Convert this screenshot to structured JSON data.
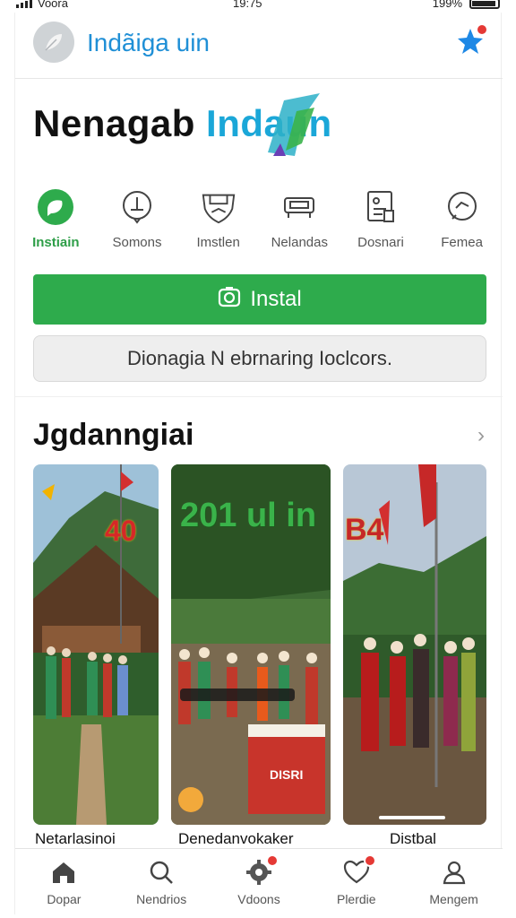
{
  "status_bar": {
    "carrier": "Voora",
    "time": "19:75",
    "battery": "199%"
  },
  "header": {
    "title": "Indãiga uin",
    "logo_icon": "leaf-icon",
    "notification_icon": "star-icon",
    "notification_dot_color": "#e53935"
  },
  "hero": {
    "title_part1": "Nenagab",
    "title_part2": "Indaun"
  },
  "quick_actions": [
    {
      "label": "Instiain",
      "icon": "chat-bubble-icon",
      "active": true
    },
    {
      "label": "Somons",
      "icon": "pin-icon",
      "active": false
    },
    {
      "label": "Imstlen",
      "icon": "shield-icon",
      "active": false
    },
    {
      "label": "Nelandas",
      "icon": "sofa-icon",
      "active": false
    },
    {
      "label": "Dosnari",
      "icon": "document-icon",
      "active": false
    },
    {
      "label": "Femea",
      "icon": "message-icon",
      "active": false
    }
  ],
  "install_button": {
    "label": "Instal",
    "icon": "camera-icon",
    "color": "#2eab4c"
  },
  "secondary_button": {
    "label": "Dionagia N ebrnaring Ioclcors."
  },
  "section": {
    "title": "Jgdanngiai"
  },
  "cards": [
    {
      "caption": "Netarlasinoi",
      "overlay_text": "40"
    },
    {
      "caption": "Denedanvokaker",
      "overlay_text": "201 ul in",
      "banner_text": "DISRI"
    },
    {
      "caption": "Distbal",
      "overlay_text": "B4"
    }
  ],
  "tab_bar": [
    {
      "label": "Dopar",
      "icon": "home-icon",
      "badge": false
    },
    {
      "label": "Nendrios",
      "icon": "search-icon",
      "badge": false
    },
    {
      "label": "Vdoons",
      "icon": "gear-icon",
      "badge": true
    },
    {
      "label": "Plerdie",
      "icon": "heart-icon",
      "badge": true
    },
    {
      "label": "Mengem",
      "icon": "profile-icon",
      "badge": false
    }
  ]
}
